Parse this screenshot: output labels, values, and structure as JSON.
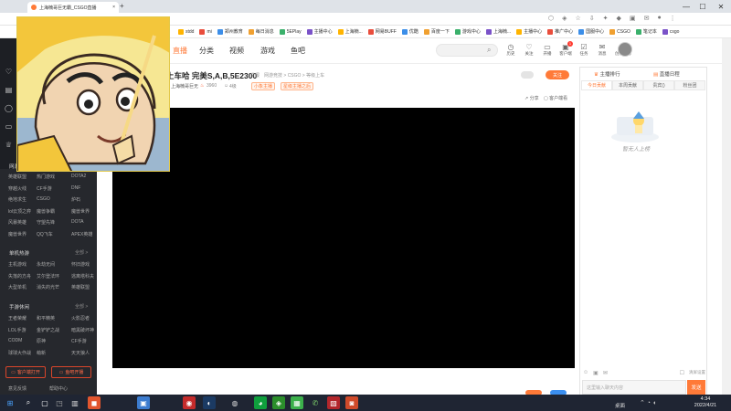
{
  "browser": {
    "tab_title": "上海楠哥巨无霸_CSGO直播",
    "tab_close": "×",
    "new_tab": "+",
    "window_controls": [
      "—",
      "☐",
      "✕"
    ],
    "bookmarks": [
      "stdd",
      "mi",
      "郑州教育",
      "每日消息",
      "5EPlay",
      "主播中心",
      "上海楠...",
      "网易BUFF",
      "优酷",
      "百度一下",
      "游戏中心",
      "上海楠...",
      "主播中心",
      "推广中心",
      "国服中心",
      "CSGO",
      "笔记本",
      "csgo"
    ]
  },
  "site": {
    "nav": [
      "直播",
      "分类",
      "视频",
      "游戏",
      "鱼吧"
    ],
    "header_icons": [
      {
        "icon": "history-icon",
        "label": "历史"
      },
      {
        "icon": "follow-icon",
        "label": "关注"
      },
      {
        "icon": "broadcast-icon",
        "label": "开播"
      },
      {
        "icon": "client-icon",
        "label": "客户端"
      },
      {
        "icon": "task-icon",
        "label": "任务"
      },
      {
        "icon": "message-icon",
        "label": "消息"
      },
      {
        "icon": "creator-icon",
        "label": "创作中心"
      }
    ],
    "notification_count": "1"
  },
  "room": {
    "title": "上车哈 完美S,A,B,5E2300",
    "report_link": "举报",
    "category_line": "网游竞技 > CSGO > 等级上车",
    "streamer": "上海楠哥巨无",
    "hot_value": "3960",
    "level": "4级",
    "tags": [
      "小象主播",
      "星级主播之后"
    ],
    "follow_button": "关注",
    "share": "分享",
    "client_watch": "客户端看"
  },
  "left_panel": {
    "sections": [
      {
        "title": "网游竞技",
        "more": "全部 >"
      },
      {
        "title": "单机热游",
        "more": "全部 >"
      },
      {
        "title": "手游休闲",
        "more": "全部 >"
      }
    ],
    "netgame_items": [
      "英雄联盟",
      "热门游戏",
      "DOTA2",
      "穿越火线",
      "CF手游",
      "DNF",
      "绝地求生",
      "CSGO",
      "炉石",
      "lol云顶之弈",
      "魔兽争霸",
      "魔兽世界",
      "风暴英雄",
      "守望先锋",
      "DOTA",
      "魔兽世界",
      "QQ飞车",
      "APEX英雄"
    ],
    "single_items": [
      "主机游戏",
      "永劫无间",
      "怀旧游戏",
      "失落的方舟",
      "艾尔登法环",
      "逃离塔科夫",
      "大型单机",
      "消失的光芒",
      "英雄联盟"
    ],
    "mobile_items": [
      "王者荣耀",
      "和平精英",
      "火影忍者",
      "LOL手游",
      "金铲铲之战",
      "暗黑破坏神",
      "CODM",
      "原神",
      "CF手游",
      "球球大作战",
      "萌新",
      "天天狼人"
    ],
    "bottom_buttons": [
      "客户端打开",
      "鱼吧开播"
    ],
    "feedback": "意见反馈",
    "help": "帮助中心"
  },
  "right_panel": {
    "rank_title": "主播排行",
    "rank_alt": "直播日程",
    "tabs": [
      "今日贡献",
      "本周贡献",
      "贵宾()",
      "粉丝团"
    ],
    "empty_text": "暂无人上榜",
    "send_button": "发送",
    "chat_placeholder": "这里输入聊天内容",
    "clear_button": "清屏设置"
  },
  "taskbar": {
    "time": "4:34",
    "date": "2022/4/21",
    "desktop": "桌面"
  },
  "colors": {
    "accent": "#ff7a38",
    "rail": "#1d1f24",
    "taskbar": "#1f2533"
  }
}
